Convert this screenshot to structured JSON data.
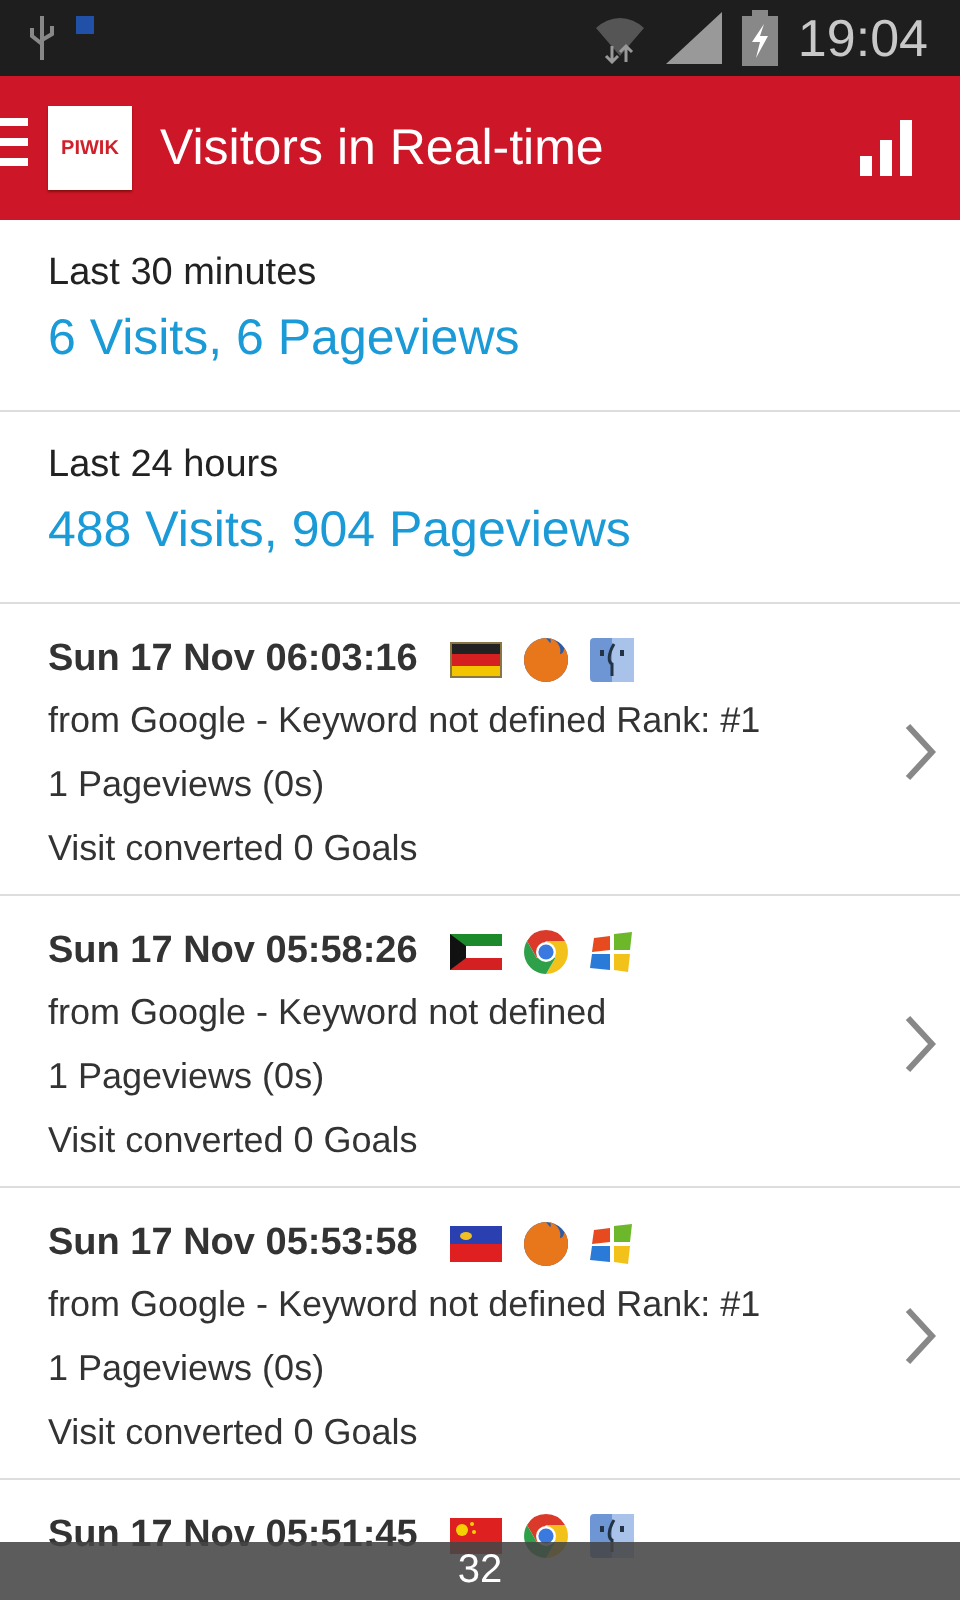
{
  "status_bar": {
    "time": "19:04"
  },
  "app_bar": {
    "logo": "PIWIK",
    "title": "Visitors in Real-time"
  },
  "summaries": [
    {
      "label": "Last 30 minutes",
      "value": "6 Visits, 6 Pageviews"
    },
    {
      "label": "Last 24 hours",
      "value": "488 Visits, 904 Pageviews"
    }
  ],
  "visits": [
    {
      "time": "Sun 17 Nov 06:03:16",
      "icons": [
        {
          "kind": "germany"
        },
        {
          "kind": "firefox"
        },
        {
          "kind": "mac"
        }
      ],
      "referrer": "from Google - Keyword not defined Rank: #1",
      "pageviews": "1 Pageviews (0s)",
      "goals": "Visit converted 0 Goals"
    },
    {
      "time": "Sun 17 Nov 05:58:26",
      "icons": [
        {
          "kind": "kuwait"
        },
        {
          "kind": "chrome"
        },
        {
          "kind": "windows"
        }
      ],
      "referrer": "from Google - Keyword not defined",
      "pageviews": "1 Pageviews (0s)",
      "goals": "Visit converted 0 Goals"
    },
    {
      "time": "Sun 17 Nov 05:53:58",
      "icons": [
        {
          "kind": "liechtenstein"
        },
        {
          "kind": "firefox"
        },
        {
          "kind": "windows"
        }
      ],
      "referrer": "from Google - Keyword not defined Rank: #1",
      "pageviews": "1 Pageviews (0s)",
      "goals": "Visit converted 0 Goals"
    },
    {
      "time": "Sun 17 Nov 05:51:45",
      "icons": [
        {
          "kind": "china"
        },
        {
          "kind": "chrome"
        },
        {
          "kind": "mac"
        }
      ]
    }
  ],
  "toast": "32"
}
